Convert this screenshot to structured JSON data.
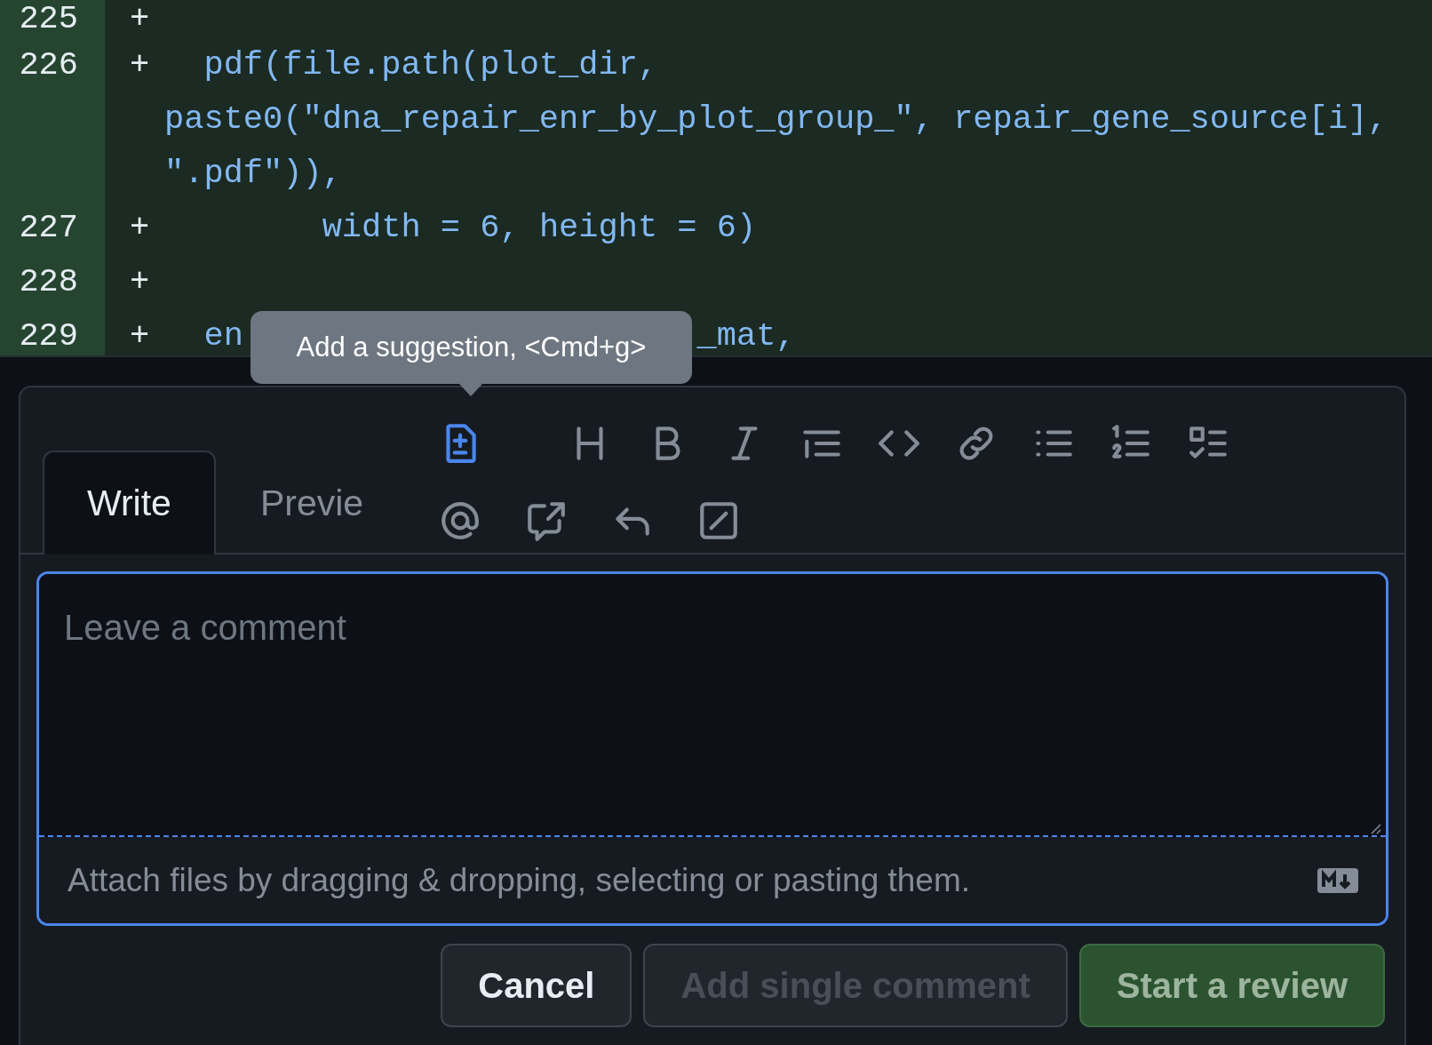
{
  "diff": {
    "lines": [
      {
        "number": "225",
        "sign": "+"
      },
      {
        "number": "226",
        "sign": "+",
        "segments": [
          "  pdf(file.path(plot_dir, paste0(\"dna_repair_enr_by_plot_group_\", repair_gene_source[i], \".pdf\")),"
        ]
      },
      {
        "number": "227",
        "sign": "+",
        "segments": [
          "        width = 6, height = 6)"
        ]
      },
      {
        "number": "228",
        "sign": "+"
      },
      {
        "number": "229",
        "sign": "+",
        "segments": [
          "  en",
          "_mat,"
        ]
      }
    ]
  },
  "tooltip": {
    "text": "Add a suggestion, <Cmd+g>"
  },
  "editor": {
    "tabs": [
      {
        "label": "Write",
        "selected": true
      },
      {
        "label": "Previe",
        "selected": false
      }
    ],
    "toolbar_rows": [
      [
        {
          "kind": "suggestion",
          "highlighted": true
        },
        {
          "kind": "heading",
          "highlighted": false
        },
        {
          "kind": "bold",
          "highlighted": false
        },
        {
          "kind": "italic",
          "highlighted": false
        },
        {
          "kind": "quote",
          "highlighted": false
        },
        {
          "kind": "code",
          "highlighted": false
        },
        {
          "kind": "link",
          "highlighted": false
        },
        {
          "kind": "bulleted-list",
          "highlighted": false
        },
        {
          "kind": "numbered-list",
          "highlighted": false
        },
        {
          "kind": "task-list",
          "highlighted": false
        }
      ],
      [
        {
          "kind": "mention",
          "highlighted": false
        },
        {
          "kind": "reference",
          "highlighted": false
        },
        {
          "kind": "reply",
          "highlighted": false
        },
        {
          "kind": "slash",
          "highlighted": false
        }
      ]
    ],
    "comment": {
      "placeholder": "Leave a comment",
      "focused": true
    },
    "attach_hint": "Attach files by dragging & dropping, selecting or pasting them.",
    "buttons": [
      {
        "label": "Cancel",
        "kind": "default",
        "disabled": false
      },
      {
        "label": "Add single comment",
        "kind": "default",
        "disabled": true
      },
      {
        "label": "Start a review",
        "kind": "primary",
        "disabled": true
      }
    ]
  }
}
